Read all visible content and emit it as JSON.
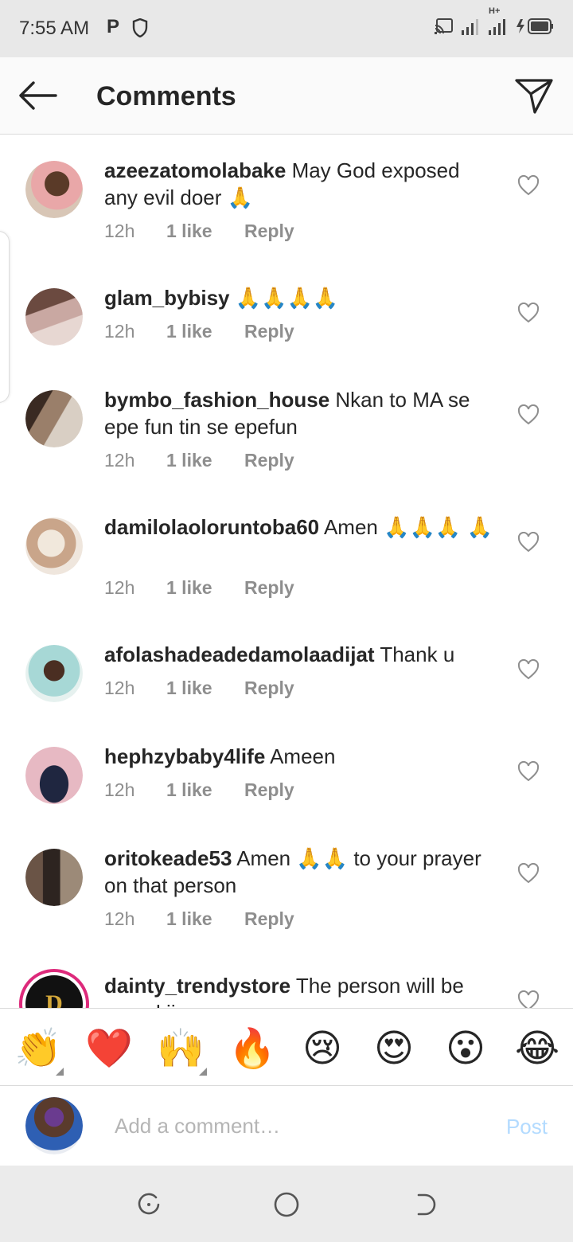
{
  "status_bar": {
    "time": "7:55 AM",
    "p_icon": "P",
    "network": "H+",
    "icons": [
      "parking-icon",
      "shield-icon",
      "cast-icon",
      "signal-icon",
      "signal-hplus-icon",
      "battery-charging-icon"
    ]
  },
  "header": {
    "title": "Comments",
    "back_icon": "back-arrow-icon",
    "action_icon": "paper-plane-icon"
  },
  "comments": [
    {
      "username": "azeezatomolabake",
      "text": "May God exposed any evil doer 🙏",
      "time": "12h",
      "likes": "1 like",
      "reply": "Reply"
    },
    {
      "username": "glam_bybisy",
      "text": "🙏🙏🙏🙏",
      "time": "12h",
      "likes": "1 like",
      "reply": "Reply"
    },
    {
      "username": "bymbo_fashion_house",
      "text": "Nkan to MA se epe fun tin se epefun",
      "time": "12h",
      "likes": "1 like",
      "reply": "Reply"
    },
    {
      "username": "damilolaoloruntoba60",
      "text": "Amen 🙏🙏🙏 🙏",
      "time": "12h",
      "likes": "1 like",
      "reply": "Reply"
    },
    {
      "username": "afolashadeadedamolaadijat",
      "text": "Thank u",
      "time": "12h",
      "likes": "1 like",
      "reply": "Reply"
    },
    {
      "username": "hephzybaby4life",
      "text": "Ameen",
      "time": "12h",
      "likes": "1 like",
      "reply": "Reply"
    },
    {
      "username": "oritokeade53",
      "text": "Amen 🙏🙏 to your prayer on that person",
      "time": "12h",
      "likes": "1 like",
      "reply": "Reply"
    },
    {
      "username": "dainty_trendystore",
      "text": "The person will be reveal ijn",
      "time": "",
      "likes": "",
      "reply": ""
    }
  ],
  "emoji_bar": [
    "👏",
    "❤️",
    "🙌",
    "🔥",
    "😢",
    "😍",
    "😮",
    "😂"
  ],
  "comment_input": {
    "placeholder": "Add a comment…",
    "post_label": "Post"
  },
  "nav_bar": [
    "recents-icon",
    "home-circle-icon",
    "back-nav-icon"
  ],
  "colors": {
    "username_text": "#262626",
    "meta_text": "#8e8e8e",
    "post_disabled": "#b3dbff",
    "status_bar_bg": "#e8e8e8",
    "nav_bar_bg": "#ebebeb",
    "story_ring": "#dd2a7b"
  }
}
